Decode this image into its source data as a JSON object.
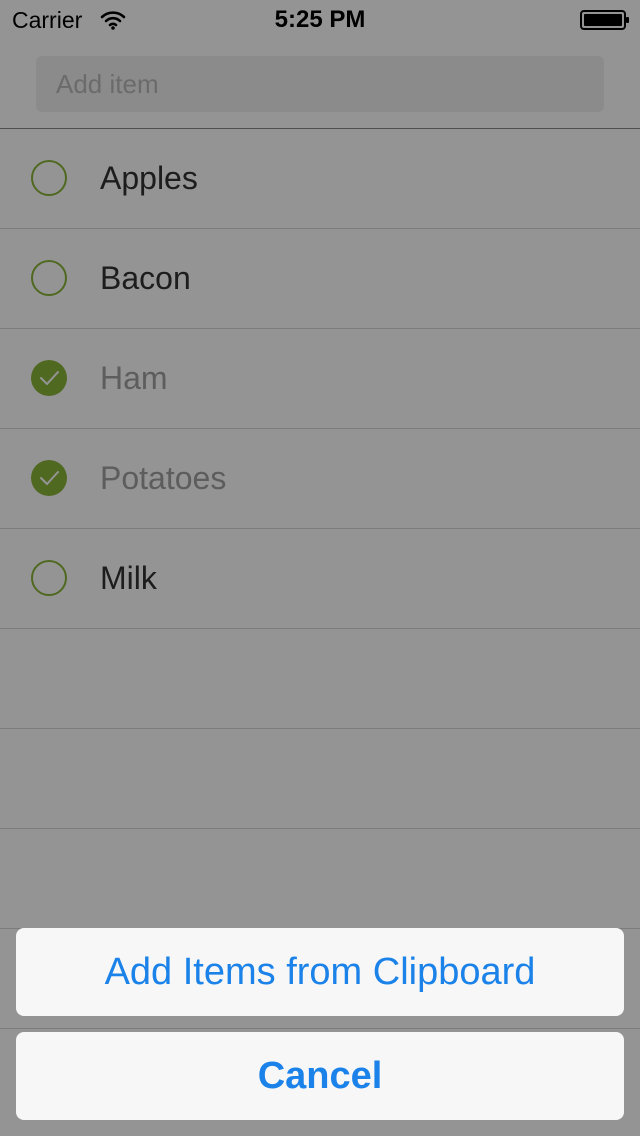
{
  "status_bar": {
    "carrier": "Carrier",
    "time": "5:25 PM",
    "wifi_icon": "wifi-icon",
    "battery_icon": "battery-icon"
  },
  "add_item": {
    "placeholder": "Add item"
  },
  "items": [
    {
      "label": "Apples",
      "checked": false
    },
    {
      "label": "Bacon",
      "checked": false
    },
    {
      "label": "Ham",
      "checked": true
    },
    {
      "label": "Potatoes",
      "checked": true
    },
    {
      "label": "Milk",
      "checked": false
    }
  ],
  "action_sheet": {
    "primary_label": "Add Items from Clipboard",
    "cancel_label": "Cancel"
  },
  "colors": {
    "accent_green": "#8bb53a",
    "action_blue": "#1a82e8"
  }
}
